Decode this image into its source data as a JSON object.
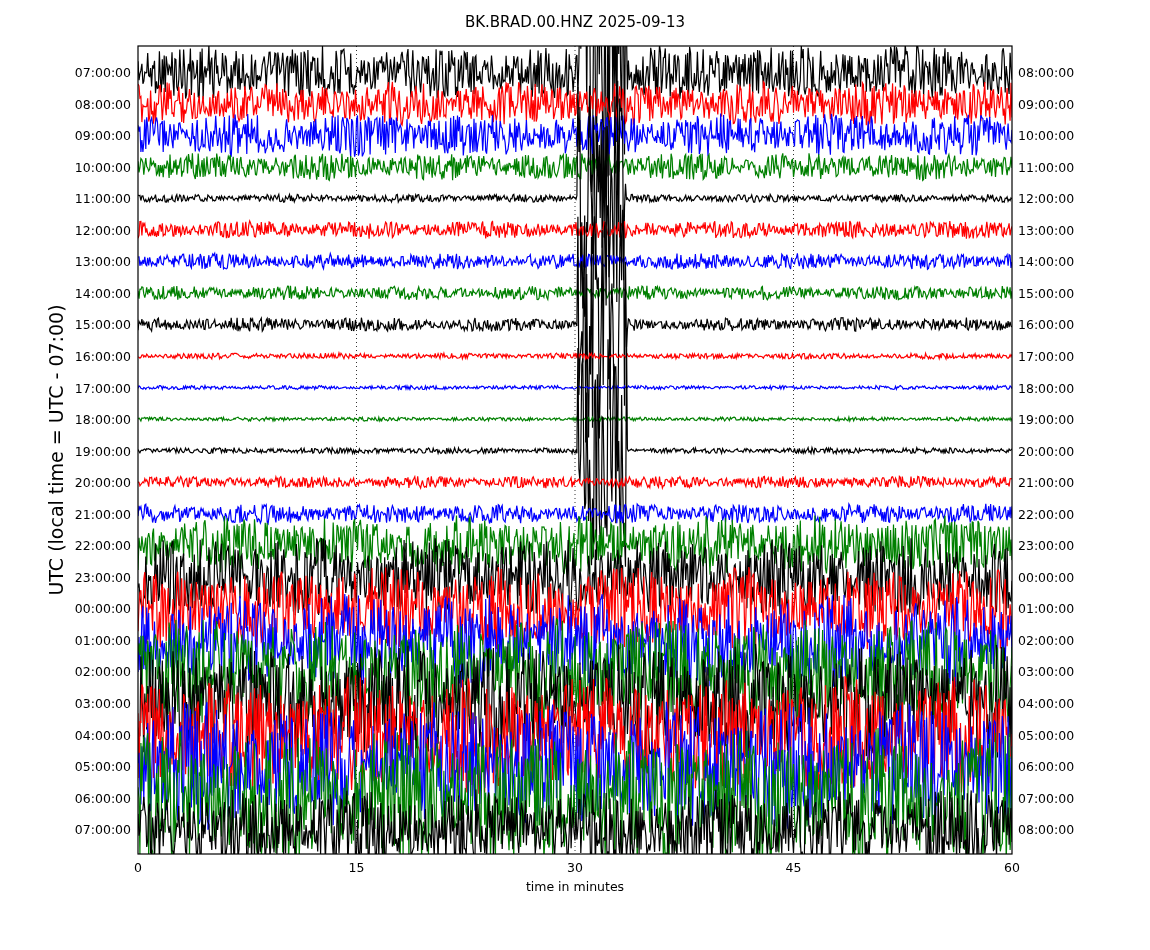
{
  "title": "BK.BRAD.00.HNZ 2025-09-13",
  "ylabel": "UTC (local time = UTC - 07:00)",
  "xlabel": "time in minutes",
  "xticks": [
    "0",
    "15",
    "30",
    "45",
    "60"
  ],
  "rows": [
    {
      "left": "07:00:00",
      "right": "08:00:00",
      "color": "#000000"
    },
    {
      "left": "08:00:00",
      "right": "09:00:00",
      "color": "#ff0000"
    },
    {
      "left": "09:00:00",
      "right": "10:00:00",
      "color": "#0000ff"
    },
    {
      "left": "10:00:00",
      "right": "11:00:00",
      "color": "#008000"
    },
    {
      "left": "11:00:00",
      "right": "12:00:00",
      "color": "#000000"
    },
    {
      "left": "12:00:00",
      "right": "13:00:00",
      "color": "#ff0000"
    },
    {
      "left": "13:00:00",
      "right": "14:00:00",
      "color": "#0000ff"
    },
    {
      "left": "14:00:00",
      "right": "15:00:00",
      "color": "#008000"
    },
    {
      "left": "15:00:00",
      "right": "16:00:00",
      "color": "#000000"
    },
    {
      "left": "16:00:00",
      "right": "17:00:00",
      "color": "#ff0000"
    },
    {
      "left": "17:00:00",
      "right": "18:00:00",
      "color": "#0000ff"
    },
    {
      "left": "18:00:00",
      "right": "19:00:00",
      "color": "#008000"
    },
    {
      "left": "19:00:00",
      "right": "20:00:00",
      "color": "#000000"
    },
    {
      "left": "20:00:00",
      "right": "21:00:00",
      "color": "#ff0000"
    },
    {
      "left": "21:00:00",
      "right": "22:00:00",
      "color": "#0000ff"
    },
    {
      "left": "22:00:00",
      "right": "23:00:00",
      "color": "#008000"
    },
    {
      "left": "23:00:00",
      "right": "00:00:00",
      "color": "#000000"
    },
    {
      "left": "00:00:00",
      "right": "01:00:00",
      "color": "#ff0000"
    },
    {
      "left": "01:00:00",
      "right": "02:00:00",
      "color": "#0000ff"
    },
    {
      "left": "02:00:00",
      "right": "03:00:00",
      "color": "#008000"
    },
    {
      "left": "03:00:00",
      "right": "04:00:00",
      "color": "#000000"
    },
    {
      "left": "04:00:00",
      "right": "05:00:00",
      "color": "#ff0000"
    },
    {
      "left": "05:00:00",
      "right": "06:00:00",
      "color": "#0000ff"
    },
    {
      "left": "06:00:00",
      "right": "07:00:00",
      "color": "#008000"
    },
    {
      "left": "07:00:00",
      "right": "08:00:00",
      "color": "#000000"
    }
  ]
}
